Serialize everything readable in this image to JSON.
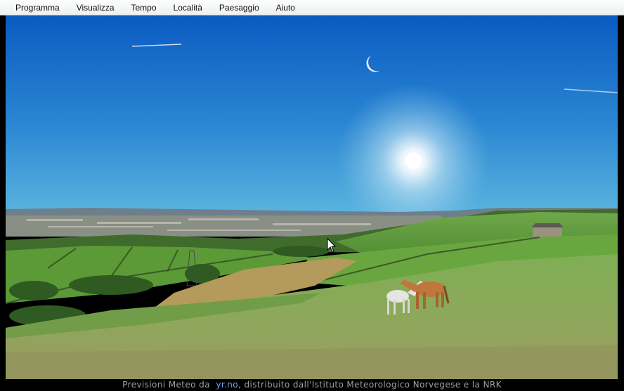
{
  "menu": {
    "items": [
      {
        "label": "Programma"
      },
      {
        "label": "Visualizza"
      },
      {
        "label": "Tempo"
      },
      {
        "label": "Località"
      },
      {
        "label": "Paesaggio"
      },
      {
        "label": "Aiuto"
      }
    ]
  },
  "scene": {
    "sky_top_color": "#0c5fc4",
    "sky_bottom_color": "#4aa6d9",
    "grass_color": "#5f9a3c",
    "icons": [
      "moon-icon",
      "sun-icon",
      "cursor-icon"
    ]
  },
  "status": {
    "prefix": "Previsioni Meteo da",
    "link": "yr.no",
    "suffix": ", distribuito dall'Istituto Meteorologico Norvegese e la NRK"
  }
}
